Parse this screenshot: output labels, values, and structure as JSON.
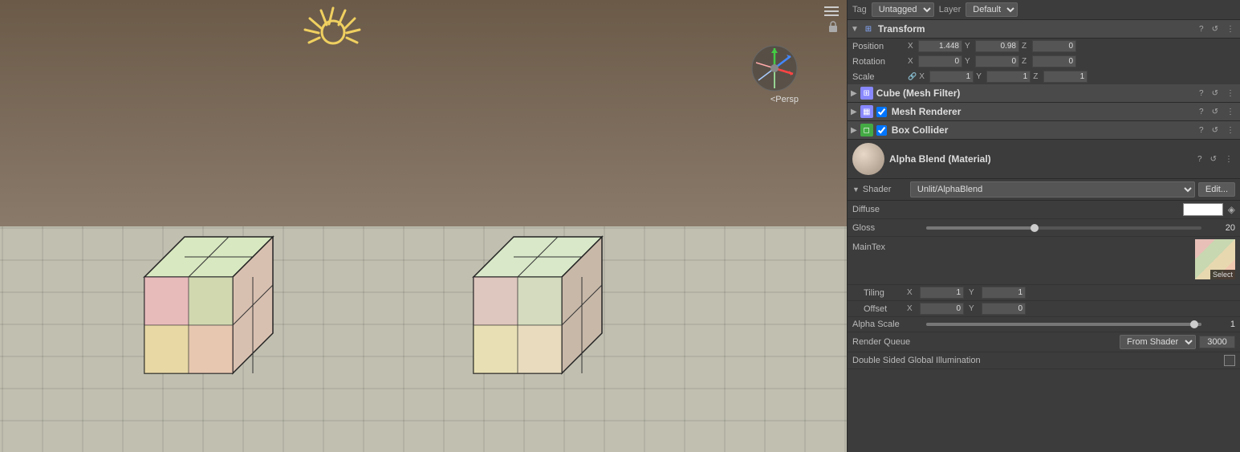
{
  "viewport": {
    "persp_label": "<Persp"
  },
  "inspector": {
    "tag_label": "Tag",
    "tag_value": "Untagged",
    "layer_label": "Layer",
    "layer_value": "Default",
    "transform": {
      "title": "Transform",
      "position_label": "Position",
      "position": {
        "x": "1.448",
        "y": "0.98",
        "z": "0"
      },
      "rotation_label": "Rotation",
      "rotation": {
        "x": "0",
        "y": "0",
        "z": "0"
      },
      "scale_label": "Scale",
      "scale": {
        "x": "1",
        "y": "1",
        "z": "1"
      }
    },
    "mesh_filter": {
      "title": "Cube (Mesh Filter)"
    },
    "mesh_renderer": {
      "title": "Mesh Renderer",
      "checked": true
    },
    "box_collider": {
      "title": "Box Collider",
      "checked": true
    },
    "material": {
      "name": "Alpha Blend (Material)",
      "shader_label": "Shader",
      "shader_value": "Unlit/AlphaBlend",
      "edit_btn": "Edit..."
    },
    "diffuse": {
      "label": "Diffuse"
    },
    "gloss": {
      "label": "Gloss",
      "value": "20"
    },
    "maintex": {
      "label": "MainTex"
    },
    "tiling": {
      "label": "Tiling",
      "x": "1",
      "y": "1"
    },
    "offset": {
      "label": "Offset",
      "x": "0",
      "y": "0"
    },
    "alpha_scale": {
      "label": "Alpha Scale",
      "value": "1"
    },
    "render_queue": {
      "label": "Render Queue",
      "dropdown": "From Shader",
      "value": "3000"
    },
    "double_sided": {
      "label": "Double Sided Global Illumination"
    },
    "select_label": "Select"
  }
}
